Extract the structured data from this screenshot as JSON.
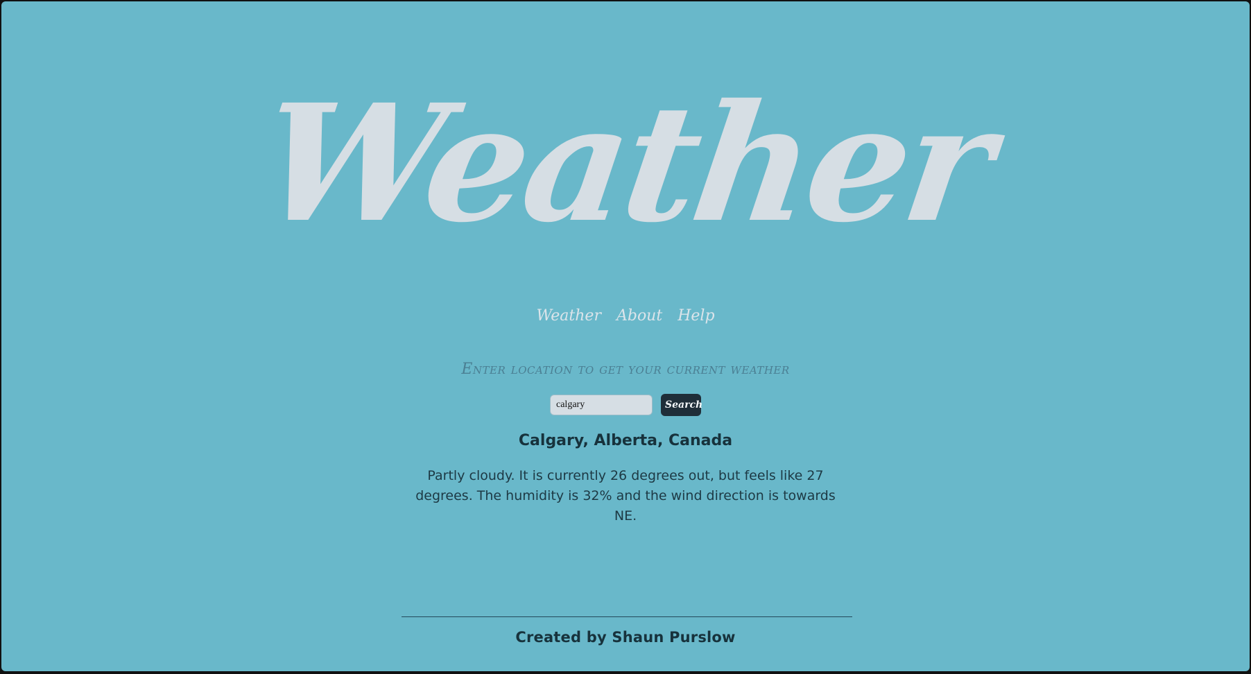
{
  "header": {
    "title": "Weather"
  },
  "nav": {
    "items": [
      {
        "label": "Weather"
      },
      {
        "label": "About"
      },
      {
        "label": "Help"
      }
    ]
  },
  "search": {
    "prompt": "Enter location to get your current weather",
    "value": "calgary",
    "button_label": "Search"
  },
  "result": {
    "location": "Calgary, Alberta, Canada",
    "description": "Partly cloudy. It is currently 26 degrees out, but feels like 27 degrees. The humidity is 32% and the wind direction is towards NE."
  },
  "footer": {
    "credit": "Created by Shaun Purslow"
  },
  "colors": {
    "background": "#69b8ca",
    "title": "#d6dee4",
    "button": "#1f2e39",
    "text": "#17323c"
  }
}
